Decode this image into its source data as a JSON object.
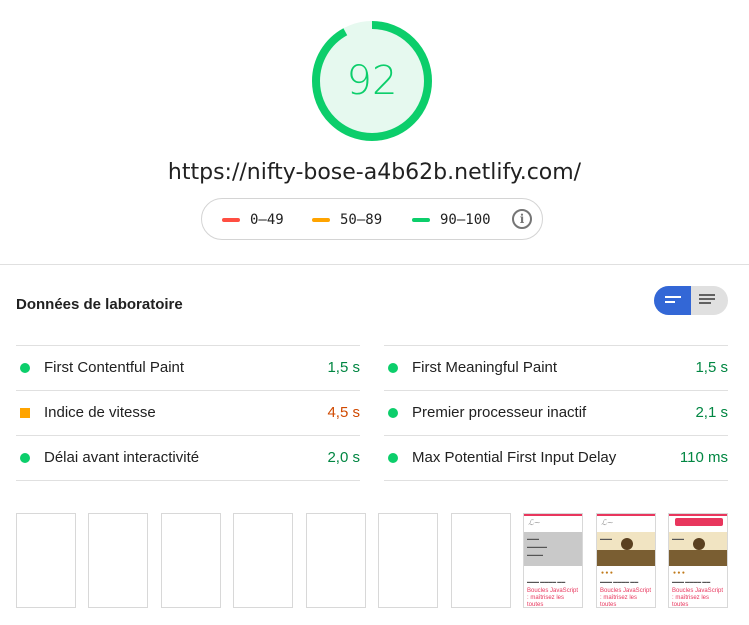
{
  "score": {
    "value": "92",
    "fraction": 0.92,
    "color": "#0cce6b",
    "track_color": "#e6f9ef"
  },
  "url": "https://nifty-bose-a4b62b.netlify.com/",
  "legend": {
    "items": [
      {
        "label": "0–49",
        "color": "#ff4e42"
      },
      {
        "label": "50–89",
        "color": "#ffa400"
      },
      {
        "label": "90–100",
        "color": "#0cce6b"
      }
    ],
    "info_icon": "info-icon"
  },
  "section": {
    "title": "Données de laboratoire",
    "toggle": {
      "left_icon": "list-compact-icon",
      "right_icon": "list-expanded-icon",
      "active_color": "#3367d6"
    }
  },
  "metrics": [
    {
      "label": "First Contentful Paint",
      "value": "1,5 s",
      "status": "pass",
      "color": "#018642"
    },
    {
      "label": "First Meaningful Paint",
      "value": "1,5 s",
      "status": "pass",
      "color": "#018642"
    },
    {
      "label": "Indice de vitesse",
      "value": "4,5 s",
      "status": "average",
      "color": "#d04900"
    },
    {
      "label": "Premier processeur inactif",
      "value": "2,1 s",
      "status": "pass",
      "color": "#018642"
    },
    {
      "label": "Délai avant interactivité",
      "value": "2,0 s",
      "status": "pass",
      "color": "#018642"
    },
    {
      "label": "Max Potential First Input Delay",
      "value": "110 ms",
      "status": "pass",
      "color": "#018642"
    }
  ],
  "filmstrip": {
    "blank_frames": 7,
    "loaded_frames": [
      {
        "headline": "Boucles JavaScript : maîtrisez les toutes",
        "hero": "gray"
      },
      {
        "headline": "Boucles JavaScript : maîtrisez les toutes",
        "hero": "photo"
      },
      {
        "headline": "Boucles JavaScript : maîtrisez les toutes",
        "hero": "photo"
      }
    ]
  }
}
